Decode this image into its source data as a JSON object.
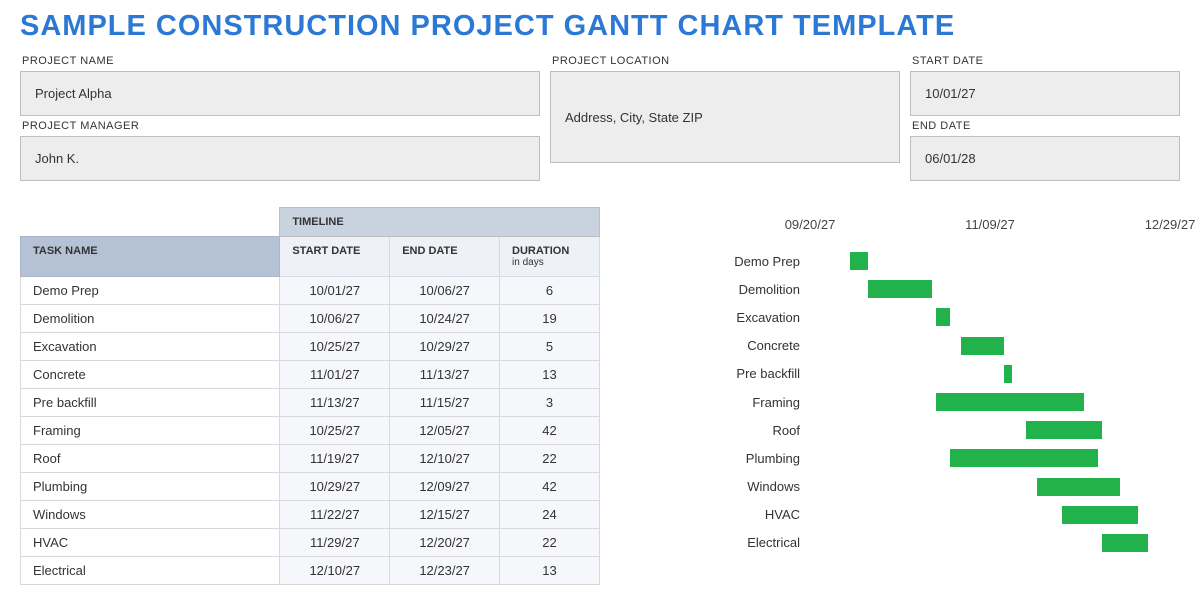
{
  "title": "SAMPLE CONSTRUCTION PROJECT GANTT CHART TEMPLATE",
  "meta": {
    "project_name_label": "PROJECT NAME",
    "project_name": "Project Alpha",
    "project_manager_label": "PROJECT MANAGER",
    "project_manager": "John K.",
    "project_location_label": "PROJECT LOCATION",
    "project_location": "Address, City, State ZIP",
    "start_date_label": "START DATE",
    "start_date": "10/01/27",
    "end_date_label": "END DATE",
    "end_date": "06/01/28"
  },
  "table": {
    "timeline_label": "TIMELINE",
    "col_task": "TASK NAME",
    "col_start": "START DATE",
    "col_start_sub": "",
    "col_end": "END DATE",
    "col_end_sub": "",
    "col_duration": "DURATION",
    "col_duration_sub": "in days",
    "rows": [
      {
        "task": "Demo Prep",
        "start": "10/01/27",
        "end": "10/06/27",
        "duration": 6
      },
      {
        "task": "Demolition",
        "start": "10/06/27",
        "end": "10/24/27",
        "duration": 19
      },
      {
        "task": "Excavation",
        "start": "10/25/27",
        "end": "10/29/27",
        "duration": 5
      },
      {
        "task": "Concrete",
        "start": "11/01/27",
        "end": "11/13/27",
        "duration": 13
      },
      {
        "task": "Pre backfill",
        "start": "11/13/27",
        "end": "11/15/27",
        "duration": 3
      },
      {
        "task": "Framing",
        "start": "10/25/27",
        "end": "12/05/27",
        "duration": 42
      },
      {
        "task": "Roof",
        "start": "11/19/27",
        "end": "12/10/27",
        "duration": 22
      },
      {
        "task": "Plumbing",
        "start": "10/29/27",
        "end": "12/09/27",
        "duration": 42
      },
      {
        "task": "Windows",
        "start": "11/22/27",
        "end": "12/15/27",
        "duration": 24
      },
      {
        "task": "HVAC",
        "start": "11/29/27",
        "end": "12/20/27",
        "duration": 22
      },
      {
        "task": "Electrical",
        "start": "12/10/27",
        "end": "12/23/27",
        "duration": 13
      }
    ]
  },
  "chart_data": {
    "type": "bar",
    "orientation": "horizontal-gantt",
    "x_axis_ticks": [
      "09/20/27",
      "11/09/27",
      "12/29/27"
    ],
    "x_range_days": [
      "2027-09-20",
      "2027-12-29"
    ],
    "bar_color": "#22b24c",
    "series": [
      {
        "label": "Demo Prep",
        "start": "2027-10-01",
        "end": "2027-10-06"
      },
      {
        "label": "Demolition",
        "start": "2027-10-06",
        "end": "2027-10-24"
      },
      {
        "label": "Excavation",
        "start": "2027-10-25",
        "end": "2027-10-29"
      },
      {
        "label": "Concrete",
        "start": "2027-11-01",
        "end": "2027-11-13"
      },
      {
        "label": "Pre backfill",
        "start": "2027-11-13",
        "end": "2027-11-15"
      },
      {
        "label": "Framing",
        "start": "2027-10-25",
        "end": "2027-12-05"
      },
      {
        "label": "Roof",
        "start": "2027-11-19",
        "end": "2027-12-10"
      },
      {
        "label": "Plumbing",
        "start": "2027-10-29",
        "end": "2027-12-09"
      },
      {
        "label": "Windows",
        "start": "2027-11-22",
        "end": "2027-12-15"
      },
      {
        "label": "HVAC",
        "start": "2027-11-29",
        "end": "2027-12-20"
      },
      {
        "label": "Electrical",
        "start": "2027-12-10",
        "end": "2027-12-23"
      }
    ]
  }
}
